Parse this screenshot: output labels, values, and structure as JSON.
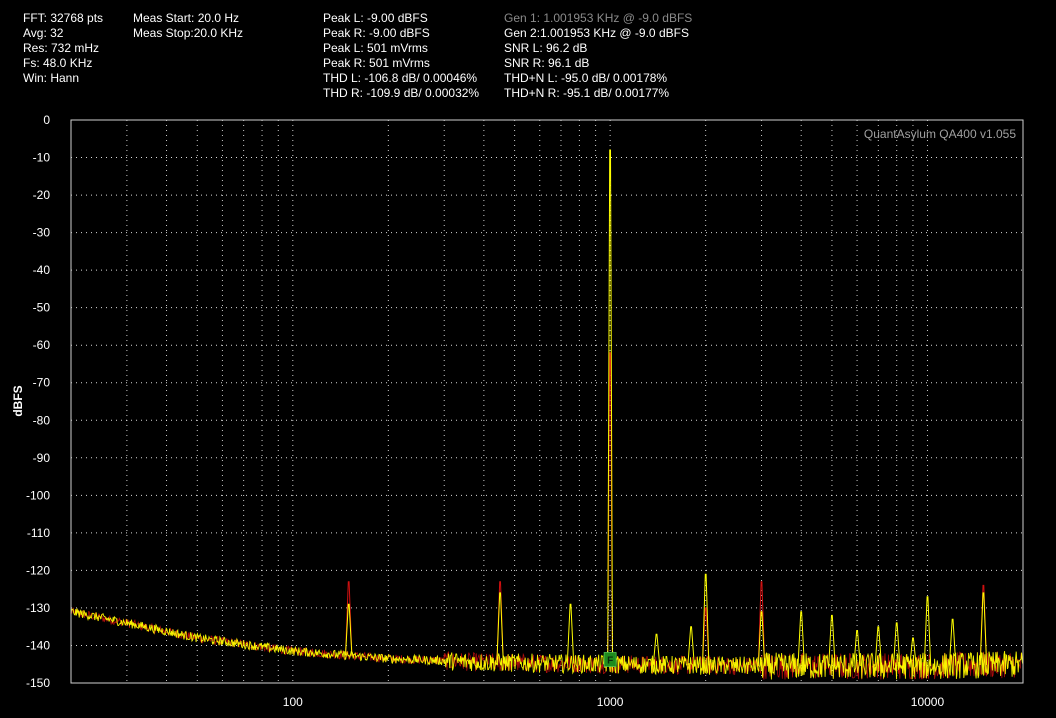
{
  "header": {
    "col1": [
      "FFT: 32768 pts",
      "Avg: 32",
      "Res: 732 mHz",
      "Fs: 48.0 KHz",
      "Win: Hann"
    ],
    "col2": [
      "Meas Start: 20.0 Hz",
      "Meas Stop:20.0 KHz"
    ],
    "col3": [
      "Peak L: -9.00 dBFS",
      "Peak R: -9.00 dBFS",
      "Peak L: 501 mVrms",
      "Peak R: 501 mVrms",
      "THD L: -106.8 dB/ 0.00046%",
      "THD R: -109.9 dB/ 0.00032%"
    ],
    "col4": [
      "Gen 1: 1.001953 KHz @ -9.0  dBFS",
      "Gen 2:1.001953 KHz @ -9.0  dBFS",
      "SNR L: 96.2 dB",
      "SNR R: 96.1 dB",
      "THD+N L: -95.0 dB/ 0.00178%",
      "THD+N R: -95.1 dB/ 0.00177%"
    ]
  },
  "watermark": "QuantAsylum QA400 v1.055",
  "colors": {
    "left_channel": "#ffff00",
    "right_channel": "#d01010",
    "marker": "#1e8c1e",
    "grid": "#ffffff",
    "background": "#000000"
  },
  "chart_data": {
    "type": "line",
    "xscale": "log",
    "xlim": [
      20,
      20000
    ],
    "ylim": [
      -150,
      0
    ],
    "ylabel": "dBFS",
    "xlabel": "",
    "xticks": [
      "100",
      "1000",
      "10000"
    ],
    "yticks": [
      "0",
      "-10",
      "-20",
      "-30",
      "-40",
      "-50",
      "-60",
      "-70",
      "-80",
      "-90",
      "-100",
      "-110",
      "-120",
      "-130",
      "-140",
      "-150"
    ],
    "grid": true,
    "marker": {
      "label": "F",
      "x": 1000,
      "y": -144
    },
    "series": [
      {
        "color": "#ffff00",
        "noise_floor": [
          [
            20,
            -131
          ],
          [
            30,
            -134
          ],
          [
            50,
            -138
          ],
          [
            100,
            -141.5
          ],
          [
            200,
            -143.5
          ],
          [
            400,
            -144.5
          ],
          [
            1000,
            -145
          ],
          [
            3000,
            -145.5
          ],
          [
            10000,
            -145.5
          ],
          [
            20000,
            -145
          ]
        ],
        "peaks": [
          [
            150,
            -129
          ],
          [
            450,
            -126
          ],
          [
            750,
            -129
          ],
          [
            1000,
            -8
          ],
          [
            1400,
            -137
          ],
          [
            1800,
            -135
          ],
          [
            2000,
            -121
          ],
          [
            3000,
            -131
          ],
          [
            4000,
            -131
          ],
          [
            5000,
            -132
          ],
          [
            6000,
            -136
          ],
          [
            7000,
            -135
          ],
          [
            8000,
            -134
          ],
          [
            9000,
            -138
          ],
          [
            10000,
            -127
          ],
          [
            12000,
            -133
          ],
          [
            15000,
            -126
          ]
        ]
      },
      {
        "color": "#d01010",
        "noise_floor": [
          [
            20,
            -131
          ],
          [
            30,
            -134
          ],
          [
            50,
            -138
          ],
          [
            100,
            -141.5
          ],
          [
            200,
            -143.5
          ],
          [
            400,
            -144.5
          ],
          [
            1000,
            -145
          ],
          [
            3000,
            -145.5
          ],
          [
            10000,
            -145.5
          ],
          [
            20000,
            -145
          ]
        ],
        "peaks": [
          [
            150,
            -123
          ],
          [
            450,
            -123
          ],
          [
            1000,
            -62
          ],
          [
            2000,
            -130
          ],
          [
            3000,
            -123
          ],
          [
            15000,
            -124
          ]
        ]
      }
    ]
  }
}
